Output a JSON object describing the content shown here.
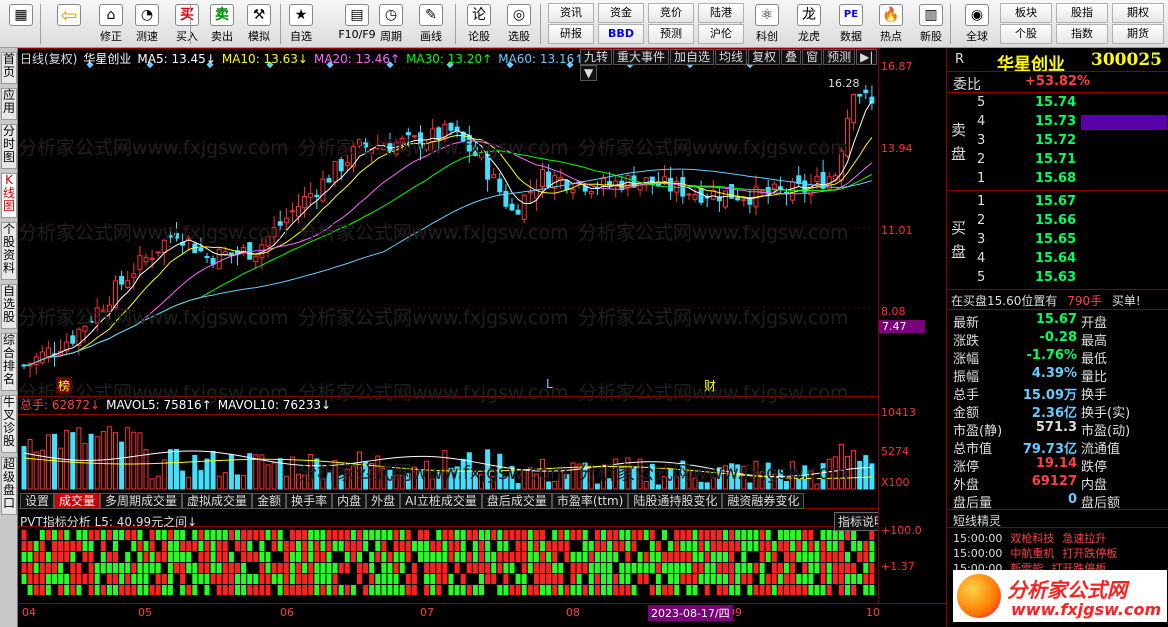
{
  "toolbar": {
    "buttons": [
      {
        "label": "",
        "icon": "grid-icon"
      },
      {
        "label": "",
        "icon": "back-arrow-icon"
      },
      {
        "label": "修正",
        "icon": "home-icon"
      },
      {
        "label": "测速",
        "icon": "speed-icon"
      },
      {
        "label": "买入",
        "icon": "buy-icon",
        "glyph": "买"
      },
      {
        "label": "卖出",
        "icon": "sell-icon",
        "glyph": "卖"
      },
      {
        "label": "模拟",
        "icon": "hammer-icon"
      },
      {
        "label": "自选",
        "icon": "star-icon"
      },
      {
        "label": "F10/F9",
        "icon": "f10-icon"
      },
      {
        "label": "周期",
        "icon": "clock-icon"
      },
      {
        "label": "画线",
        "icon": "pen-icon"
      },
      {
        "label": "论股",
        "icon": "discuss-icon"
      },
      {
        "label": "选股",
        "icon": "select-icon"
      }
    ],
    "rect_buttons": [
      "资讯",
      "资金",
      "竞价",
      "陆港",
      "研报",
      "BBD",
      "预测",
      "沪伦"
    ],
    "buttons2": [
      {
        "label": "科创",
        "icon": "kechuang-icon"
      },
      {
        "label": "龙虎",
        "icon": "dragon-icon"
      },
      {
        "label": "数据",
        "icon": "pe-icon",
        "glyph": "PE"
      },
      {
        "label": "热点",
        "icon": "hot-icon"
      },
      {
        "label": "新股",
        "icon": "ipo-icon"
      },
      {
        "label": "全球",
        "icon": "globe-icon"
      }
    ],
    "rect_buttons2": [
      "板块",
      "股指",
      "期权",
      "个股",
      "指数",
      "期货"
    ]
  },
  "left_tabs": [
    "首页",
    "应用",
    "分时图",
    "K线图",
    "个股资料",
    "自选股",
    "综合排名",
    "牛叉诊股",
    "超级盘口"
  ],
  "chart": {
    "info": [
      {
        "text": "日线(复权)",
        "color": "#dddddd"
      },
      {
        "text": "华星创业",
        "color": "#ffffff"
      },
      {
        "text": "MA5: 13.45↓",
        "color": "#ffffff"
      },
      {
        "text": "MA10: 13.63↓",
        "color": "#ffff00"
      },
      {
        "text": "MA20: 13.46↑",
        "color": "#ff66ff"
      },
      {
        "text": "MA30: 13.20↑",
        "color": "#00ff00"
      },
      {
        "text": "MA60: 13.16↑",
        "color": "#66ccff"
      }
    ],
    "top_buttons": [
      "九转",
      "重大事件",
      "加自选",
      "均线",
      "复权",
      "叠",
      "窗",
      "预测",
      "▶|",
      "▼"
    ],
    "y_labels": [
      "16.87",
      "13.94",
      "11.01",
      "8.08",
      "7.47"
    ],
    "sub_y_labels": [
      "10413",
      "5274",
      "X100"
    ],
    "pvt_y_labels": [
      "+100.0",
      "+1.37"
    ],
    "high_label": "16.28",
    "marks": [
      {
        "text": "榜"
      },
      {
        "text": "L"
      },
      {
        "text": "财"
      }
    ],
    "vol_info": [
      {
        "text": "总手: 62872↓",
        "color": "#ff4040"
      },
      {
        "text": "MAVOL5: 75816↑",
        "color": "#ffffff"
      },
      {
        "text": "MAVOL10: 76233↓",
        "color": "#ffffff"
      }
    ],
    "sub_tabs": [
      "设置",
      "成交量",
      "多周期成交量",
      "虚拟成交量",
      "金额",
      "换手率",
      "内盘",
      "外盘",
      "AI立桩成交量",
      "盘后成交量",
      "市盈率(ttm)",
      "陆股通持股变化",
      "融资融券变化"
    ],
    "pvt_info": "PVT指标分析 L5: 40.99元之间↓",
    "pvt_btn": "指标说明",
    "x_labels": [
      "04",
      "05",
      "06",
      "07",
      "08",
      "09",
      "10"
    ],
    "date_badge": "2023-08-17/四",
    "watermark": "分析家公式网www.fxjgsw.com"
  },
  "right": {
    "code_label": "R",
    "name": "华星创业",
    "code": "300025",
    "weibi_label": "委比",
    "weibi_value": "+53.82%",
    "sell_label": "卖盘",
    "buy_label": "买盘",
    "sell": [
      {
        "level": "5",
        "price": "15.74"
      },
      {
        "level": "4",
        "price": "15.73"
      },
      {
        "level": "3",
        "price": "15.72"
      },
      {
        "level": "2",
        "price": "15.71"
      },
      {
        "level": "1",
        "price": "15.68"
      }
    ],
    "buy": [
      {
        "level": "1",
        "price": "15.67"
      },
      {
        "level": "2",
        "price": "15.66"
      },
      {
        "level": "3",
        "price": "15.65"
      },
      {
        "level": "4",
        "price": "15.64"
      },
      {
        "level": "5",
        "price": "15.63"
      }
    ],
    "notice": {
      "a": "在买盘15.60位置有",
      "b": "790手",
      "c": "买单!"
    },
    "stats": [
      {
        "l": "最新",
        "v": "15.67",
        "r": "开盘",
        "vc": "#00ff60"
      },
      {
        "l": "涨跌",
        "v": "-0.28",
        "r": "最高",
        "vc": "#00ff60"
      },
      {
        "l": "涨幅",
        "v": "-1.76%",
        "r": "最低",
        "vc": "#00ff60"
      },
      {
        "l": "振幅",
        "v": "4.39%",
        "r": "量比",
        "vc": "#66ccff"
      },
      {
        "l": "总手",
        "v": "15.09万",
        "r": "换手",
        "vc": "#66ccff"
      },
      {
        "l": "金额",
        "v": "2.36亿",
        "r": "换手(实)",
        "vc": "#66ccff"
      },
      {
        "l": "市盈(静)",
        "v": "571.3",
        "r": "市盈(动)",
        "vc": "#dddddd"
      },
      {
        "l": "总市值",
        "v": "79.73亿",
        "r": "流通值",
        "vc": "#66ccff"
      },
      {
        "l": "涨停",
        "v": "19.14",
        "r": "跌停",
        "vc": "#ff4040"
      },
      {
        "l": "外盘",
        "v": "69127",
        "r": "内盘",
        "vc": "#ff4040"
      },
      {
        "l": "盘后量",
        "v": "0",
        "r": "盘后额",
        "vc": "#66ccff"
      }
    ],
    "elf_title": "短线精灵",
    "elf": [
      {
        "time": "15:00:00",
        "stock": "双枪科技",
        "event": "急速拉升"
      },
      {
        "time": "15:00:00",
        "stock": "中航重机",
        "event": "打开跌停板"
      },
      {
        "time": "15:00:00",
        "stock": "新雷能",
        "event": "打开跌停板"
      }
    ],
    "logo_text": "分析家公式网",
    "logo_url": "www.fxjgsw.com"
  },
  "colors": {
    "up": "#ff3030",
    "down": "#40e0ff",
    "grid": "#8b0000"
  }
}
